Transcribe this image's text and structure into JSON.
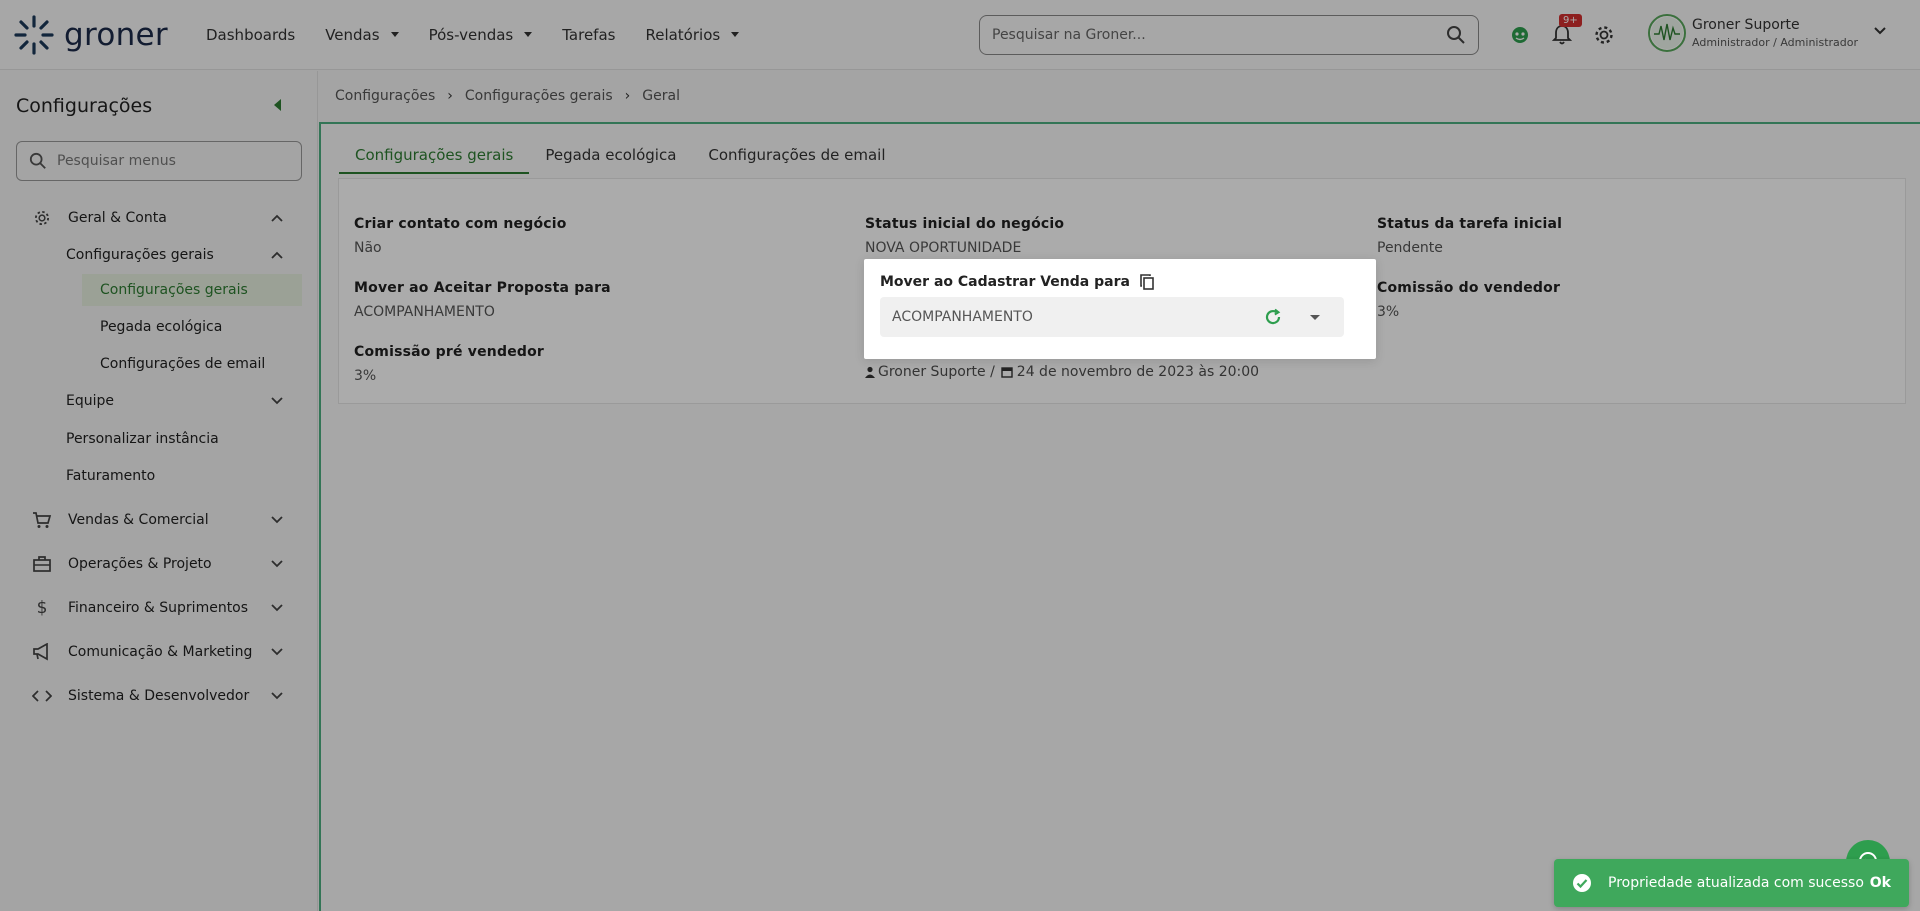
{
  "header": {
    "logo_text": "groner",
    "nav": [
      {
        "label": "Dashboards",
        "dropdown": false
      },
      {
        "label": "Vendas",
        "dropdown": true
      },
      {
        "label": "Pós-vendas",
        "dropdown": true
      },
      {
        "label": "Tarefas",
        "dropdown": false
      },
      {
        "label": "Relatórios",
        "dropdown": true
      }
    ],
    "search_placeholder": "Pesquisar na Groner...",
    "notification_badge": "9+",
    "user_name": "Groner Suporte",
    "user_role": "Administrador / Administrador"
  },
  "sidebar": {
    "title": "Configurações",
    "search_placeholder": "Pesquisar menus",
    "items": [
      {
        "label": "Geral & Conta",
        "icon": "gear-icon"
      },
      {
        "label": "Configurações gerais"
      },
      {
        "label": "Configurações gerais"
      },
      {
        "label": "Pegada ecológica"
      },
      {
        "label": "Configurações de email"
      },
      {
        "label": "Equipe"
      },
      {
        "label": "Personalizar instância"
      },
      {
        "label": "Faturamento"
      },
      {
        "label": "Vendas & Comercial",
        "icon": "cart-icon"
      },
      {
        "label": "Operações & Projeto",
        "icon": "briefcase-icon"
      },
      {
        "label": "Financeiro & Suprimentos",
        "icon": "dollar-icon"
      },
      {
        "label": "Comunicação & Marketing",
        "icon": "megaphone-icon"
      },
      {
        "label": "Sistema & Desenvolvedor",
        "icon": "code-icon"
      }
    ]
  },
  "breadcrumb": [
    "Configurações",
    "Configurações gerais",
    "Geral"
  ],
  "tabs": [
    "Configurações gerais",
    "Pegada ecológica",
    "Configurações de email"
  ],
  "fields": {
    "criar_contato": {
      "label": "Criar contato com negócio",
      "value": "Não"
    },
    "status_inicial": {
      "label": "Status inicial do negócio",
      "value": "NOVA OPORTUNIDADE"
    },
    "status_tarefa": {
      "label": "Status da tarefa inicial",
      "value": "Pendente"
    },
    "mover_aceitar": {
      "label": "Mover ao Aceitar Proposta para",
      "value": "ACOMPANHAMENTO"
    },
    "comissao_vendedor": {
      "label": "Comissão do vendedor",
      "value": "3%"
    },
    "comissao_pre": {
      "label": "Comissão pré vendedor",
      "value": "3%"
    }
  },
  "popup": {
    "label": "Mover ao Cadastrar Venda para",
    "value": "ACOMPANHAMENTO"
  },
  "meta": {
    "user": "Groner Suporte /",
    "date": "24 de novembro de 2023 às 20:00"
  },
  "toast": {
    "message": "Propriedade atualizada com sucesso",
    "action": "Ok"
  },
  "colors": {
    "accent": "#2e7d32",
    "toast": "#3fa85c",
    "content_border": "#4caf80"
  }
}
